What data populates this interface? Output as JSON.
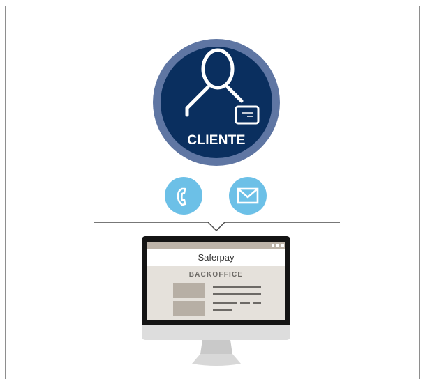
{
  "client": {
    "label": "CLIENTE",
    "icon": "client-person-icon"
  },
  "channels": [
    {
      "name": "phone",
      "icon": "phone-icon"
    },
    {
      "name": "email",
      "icon": "envelope-icon"
    }
  ],
  "backoffice": {
    "app_name": "Saferpay",
    "section_title": "BACKOFFICE"
  },
  "colors": {
    "navy": "#0a2f5f",
    "ring": "#5f76a3",
    "bubble": "#6cc0e7",
    "screen_bg": "#e5e1db",
    "screen_bar": "#bdb4a9"
  }
}
